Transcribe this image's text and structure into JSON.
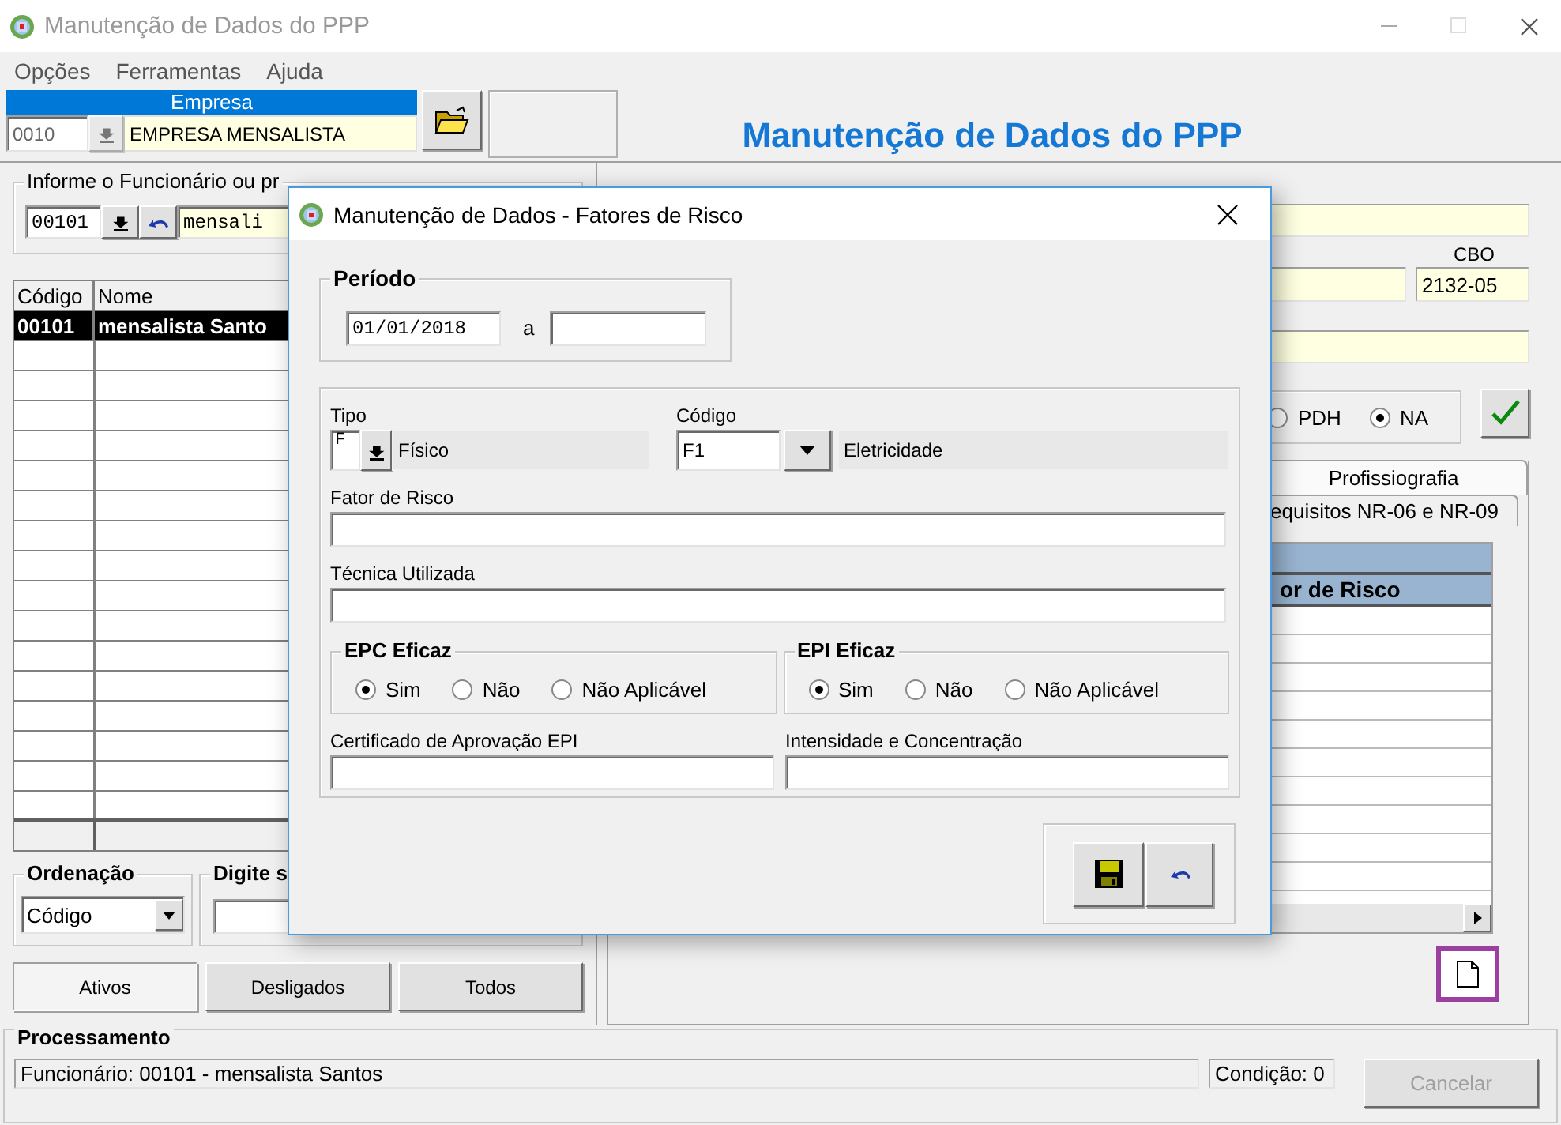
{
  "window": {
    "title": "Manutenção de Dados do PPP",
    "menu": [
      "Opções",
      "Ferramentas",
      "Ajuda"
    ]
  },
  "empresa": {
    "label": "Empresa",
    "code": "0010",
    "name": "EMPRESA MENSALISTA"
  },
  "page_title": "Manutenção de Dados do PPP",
  "employee_search": {
    "label": "Informe o Funcionário ou pr",
    "code": "00101",
    "name": "mensali"
  },
  "employee_table": {
    "columns": [
      "Código",
      "Nome"
    ],
    "rows": [
      {
        "code": "00101",
        "name": "mensalista Santo",
        "selected": true
      }
    ]
  },
  "ordering": {
    "label": "Ordenação",
    "value": "Código"
  },
  "search": {
    "label": "Digite s"
  },
  "filter_buttons": [
    {
      "label": "Ativos",
      "selected": true
    },
    {
      "label": "Desligados",
      "selected": false
    },
    {
      "label": "Todos",
      "selected": false
    }
  ],
  "cbo": {
    "label": "CBO",
    "value": "2132-05"
  },
  "options": [
    {
      "label": "PDH",
      "selected": false
    },
    {
      "label": "NA",
      "selected": true
    }
  ],
  "tabs": [
    {
      "label": "Profissiografia",
      "selected": true
    }
  ],
  "subtab": "equisitos NR-06 e NR-09",
  "risk_grid": {
    "column": "or de Risco"
  },
  "processing": {
    "label": "Processamento",
    "message": "Funcionário: 00101 - mensalista Santos",
    "condition": "Condição: 0",
    "cancel": {
      "label": "Cancelar",
      "disabled": true
    }
  },
  "dialog": {
    "title": "Manutenção de Dados - Fatores de Risco",
    "periodo": {
      "label": "Período",
      "start": "01/01/2018",
      "separator": "a"
    },
    "tipo": {
      "label": "Tipo",
      "code": "F",
      "description": "Físico"
    },
    "codigo": {
      "label": "Código",
      "value": "F1",
      "description": "Eletricidade"
    },
    "fields": [
      {
        "label": "Fator de Risco"
      },
      {
        "label": "Técnica Utilizada"
      }
    ],
    "groups": [
      {
        "label": "EPC Eficaz",
        "options": [
          {
            "label": "Sim",
            "selected": true
          },
          {
            "label": "Não",
            "selected": false
          },
          {
            "label": "Não Aplicável",
            "selected": false
          }
        ]
      },
      {
        "label": "EPI Eficaz",
        "options": [
          {
            "label": "Sim",
            "selected": true
          },
          {
            "label": "Não",
            "selected": false
          },
          {
            "label": "Não Aplicável",
            "selected": false
          }
        ]
      }
    ],
    "bottom_fields": [
      {
        "label": "Certificado de Aprovação EPI"
      },
      {
        "label": "Intensidade e Concentração"
      }
    ]
  }
}
